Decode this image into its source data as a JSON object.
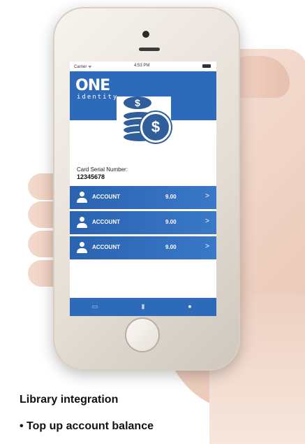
{
  "status_bar": {
    "carrier": "Carrier ᯤ",
    "time": "4:53 PM"
  },
  "app": {
    "logo_main": "ONE",
    "logo_sub": "identity",
    "coin_symbol": "$",
    "card_serial_label": "Card Serial Number:",
    "card_serial_value": "12345678",
    "accounts": [
      {
        "label": "ACCOUNT",
        "balance": "9.00",
        "chevron": ">"
      },
      {
        "label": "ACCOUNT",
        "balance": "9.00",
        "chevron": ">"
      },
      {
        "label": "ACCOUNT",
        "balance": "9.00",
        "chevron": ">"
      }
    ],
    "tab_bar": {
      "tabs": [
        "card-icon",
        "wallet-icon",
        "person-icon"
      ]
    },
    "colors": {
      "brand_blue": "#2d6ab9"
    }
  },
  "caption": {
    "title": "Library integration",
    "bullet": "• Top up account balance"
  }
}
